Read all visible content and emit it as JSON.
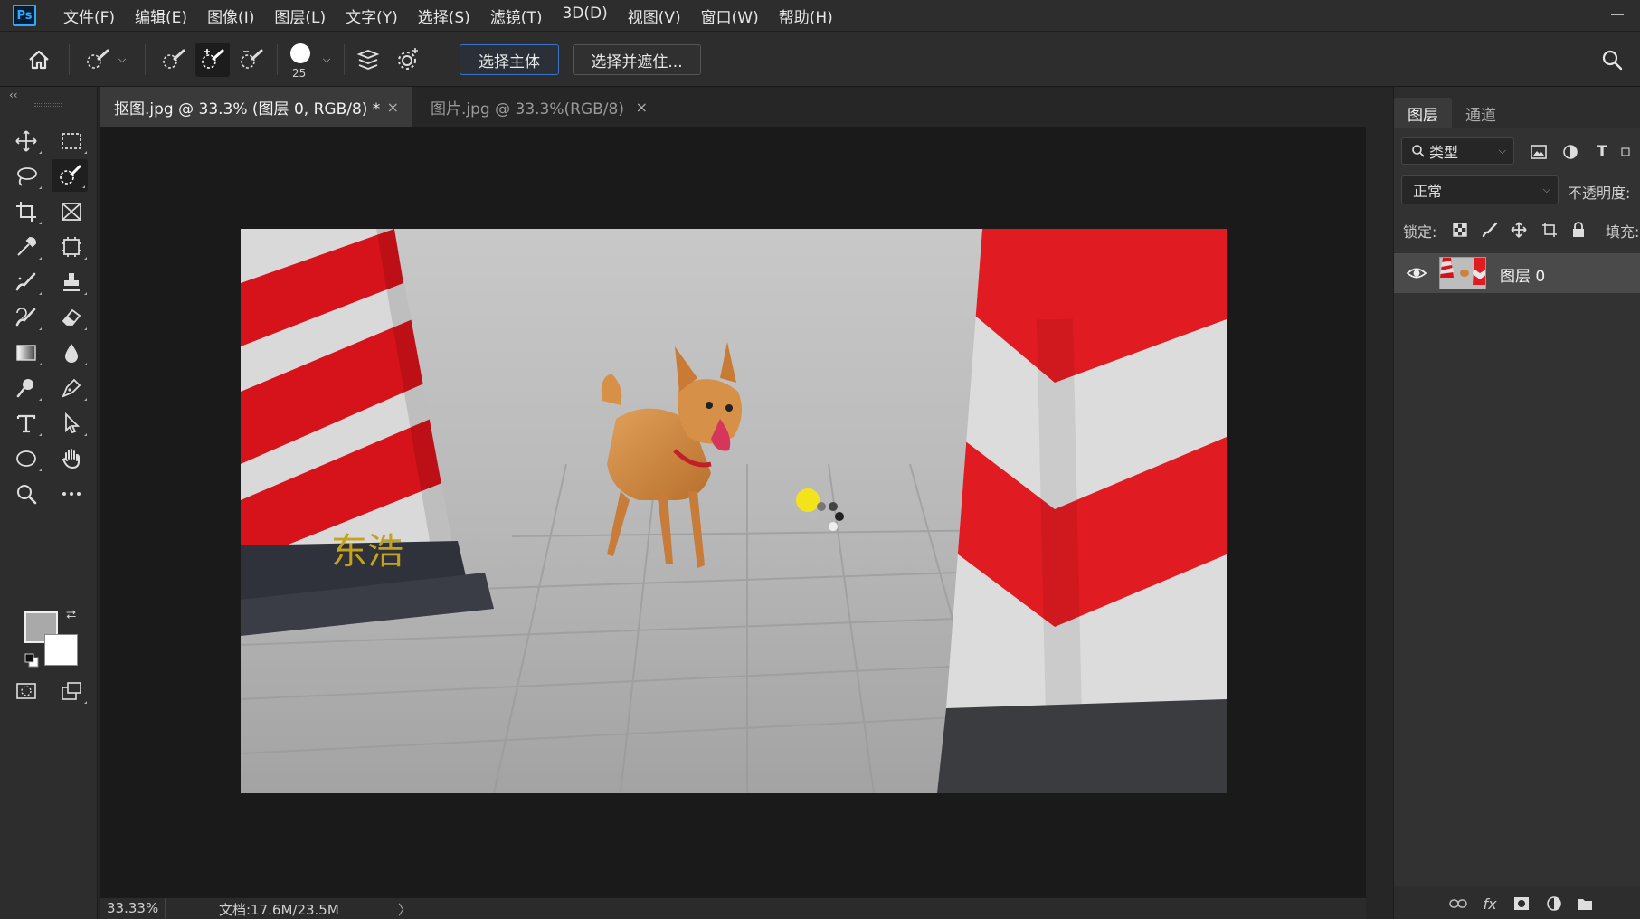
{
  "app": {
    "logo": "Ps"
  },
  "menu": [
    "文件(F)",
    "编辑(E)",
    "图像(I)",
    "图层(L)",
    "文字(Y)",
    "选择(S)",
    "滤镜(T)",
    "3D(D)",
    "视图(V)",
    "窗口(W)",
    "帮助(H)"
  ],
  "options": {
    "brush_size": "25",
    "select_subject_label": "选择主体",
    "select_and_mask_label": "选择并遮住..."
  },
  "toolbar": {
    "collapse": "‹‹",
    "swap": "⮂"
  },
  "tabs": [
    {
      "label": "抠图.jpg @ 33.3% (图层 0, RGB/8) *",
      "close": "×"
    },
    {
      "label": "图片.jpg @ 33.3%(RGB/8)",
      "close": "×"
    }
  ],
  "status": {
    "zoom": "33.33%",
    "doc_info": "文档:17.6M/23.5M",
    "arrow": "〉"
  },
  "panel": {
    "tabs": [
      "图层",
      "通道"
    ],
    "filter_label": "类型",
    "blend_mode": "正常",
    "opacity_label": "不透明度:",
    "lock_label": "锁定:",
    "fill_label": "填充:",
    "layers": [
      {
        "name": "图层 0"
      }
    ]
  },
  "colors": {
    "accent": "#31a8ff",
    "foreground": "#a9a9a9",
    "background": "#ffffff"
  }
}
